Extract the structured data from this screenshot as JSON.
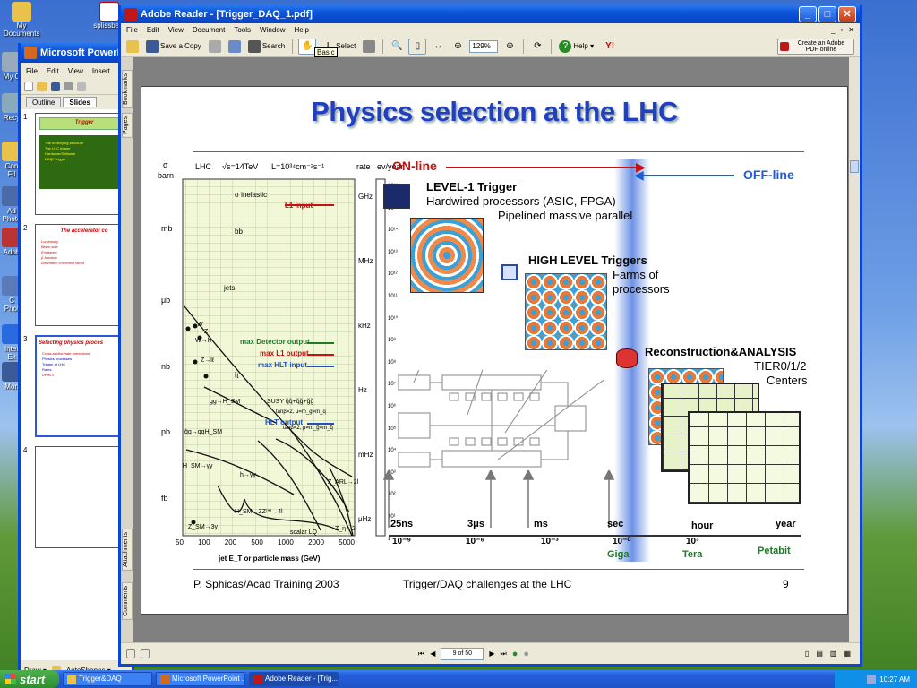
{
  "desktop": {
    "icons": [
      {
        "label": "My Documents",
        "icon": "folder-icon"
      },
      {
        "label": "splissbe...",
        "icon": "pdf-icon"
      },
      {
        "label": "My C",
        "icon": "computer-icon"
      },
      {
        "label": "Recy",
        "icon": "recycle-bin-icon"
      },
      {
        "label": "Con Fil",
        "icon": "folder-icon"
      },
      {
        "label": "Ad Photo",
        "icon": "app-icon"
      },
      {
        "label": "Adob",
        "icon": "app-icon"
      },
      {
        "label": "C Phot",
        "icon": "app-icon"
      },
      {
        "label": "Inter Ex",
        "icon": "ie-icon"
      },
      {
        "label": "Mon",
        "icon": "app-icon"
      }
    ]
  },
  "ppt": {
    "title": "Microsoft PowerPoint - [",
    "menu": [
      "File",
      "Edit",
      "View",
      "Insert"
    ],
    "tabs": [
      "Outline",
      "Slides"
    ],
    "active_tab": "Slides",
    "slides": [
      {
        "num": "1",
        "title": "Trigger",
        "lines": [
          "The underlying structure",
          "The LHC trigger",
          "Hardware/Software",
          "DAQ/ Trigger",
          ""
        ]
      },
      {
        "num": "2",
        "title": "The accelerator co",
        "lines": [
          "Luminosity",
          "Beam size",
          "Emittance",
          "β-function",
          "Geometric correction factor"
        ]
      },
      {
        "num": "3",
        "title": "Selecting physics proces",
        "lines": [
          "Cross-section/rate corrections",
          "Physics processes",
          "Trigger at LHC",
          "Rates",
          "Level-1"
        ]
      },
      {
        "num": "4",
        "title": "",
        "lines": []
      }
    ],
    "draw_label": "Draw ▾",
    "autoshapes_label": "AutoShapes ▾"
  },
  "acrobat": {
    "title": "Adobe Reader - [Trigger_DAQ_1.pdf]",
    "menu": [
      "File",
      "Edit",
      "View",
      "Document",
      "Tools",
      "Window",
      "Help"
    ],
    "toolbar": {
      "save_copy": "Save a Copy",
      "search": "Search",
      "select": "Select",
      "zoom": "129%",
      "help": "Help ▾",
      "create_pdf": "Create an Adobe PDF online",
      "tooltip": "Basic"
    },
    "side_tabs": [
      "Bookmarks",
      "Pages",
      "Attachments",
      "Comments"
    ],
    "page_indicator": "9 of 50"
  },
  "slide": {
    "title": "Physics selection at the LHC",
    "online": "ON-line",
    "offline": "OFF-line",
    "left_header": {
      "sigma": "σ",
      "barn": "barn",
      "lhc": "LHC",
      "sqrt_s": "√s=14TeV",
      "lumi": "L=10³⁴cm⁻²s⁻¹",
      "rate": "rate",
      "evyear": "ev/year"
    },
    "sigma_labels": [
      "mb",
      "μb",
      "nb",
      "pb",
      "fb"
    ],
    "rate_labels": [
      "GHz",
      "MHz",
      "kHz",
      "Hz",
      "mHz",
      "μHz"
    ],
    "ev_exponents": [
      "10¹⁶",
      "10¹⁵",
      "10¹⁴",
      "10¹³",
      "10¹²",
      "10¹¹",
      "10¹⁰",
      "10⁹",
      "10⁸",
      "10⁷",
      "10⁶",
      "10⁵",
      "10⁴",
      "10³",
      "10²",
      "10¹",
      "1"
    ],
    "processes": [
      "σ inelastic",
      "b̄b",
      "jets",
      "W",
      "Z",
      "W→lν",
      "Z→lℓ",
      "t̄t",
      "gg→H_SM",
      "q̄q→qqH_SM",
      "H_SM→γγ",
      "h→γγ",
      "SUSY q̃q̃+q̃g̃+g̃g̃",
      "tanβ=2, μ=m_g̃=m_q̃",
      "tanβ=2, μ=m_g̃=m_q̃",
      "Z_ARL→2l",
      "H_SM→ZZ⁽*⁾→4l",
      "scalar LQ",
      "Z_SM→3γ",
      "Z_η→2l"
    ],
    "thresholds": [
      "L1 input",
      "max Detector output",
      "max L1 output",
      "max HLT input",
      "HLT output"
    ],
    "x_ticks": [
      "50",
      "100",
      "200",
      "500",
      "1000",
      "2000",
      "5000"
    ],
    "x_label": "jet E_T or particle mass (GeV)",
    "level1": {
      "title": "LEVEL-1 Trigger",
      "line1": "Hardwired processors  (ASIC, FPGA)",
      "line2": "Pipelined massive parallel"
    },
    "hlt": {
      "title": "HIGH LEVEL Triggers",
      "line1": "Farms of",
      "line2": "processors"
    },
    "reco": {
      "title": "Reconstruction&ANALYSIS",
      "line1": "TIER0/1/2",
      "line2": "Centers"
    },
    "time_labels": [
      "25ns",
      "3μs",
      "ms",
      "sec",
      "hour",
      "year"
    ],
    "time_exps": [
      "10⁻⁹",
      "10⁻⁶",
      "10⁻³",
      "10⁻⁰",
      "10³",
      "10⁶"
    ],
    "data_labels": [
      "Giga",
      "Tera",
      "Petabit"
    ],
    "footer": {
      "author": "P. Sphicas/Acad Training 2003",
      "talk": "Trigger/DAQ challenges at the LHC",
      "page": "9"
    }
  },
  "taskbar": {
    "start": "start",
    "tasks": [
      "Trigger&DAQ",
      "Microsoft PowerPoint ...",
      "Adobe Reader - [Trig..."
    ],
    "clock": "10:27 AM"
  },
  "colors": {
    "online_red": "#c81010",
    "offline_blue": "#1f5cd8",
    "title_blue": "#2040c0",
    "giga_green": "#1f7a2a"
  }
}
